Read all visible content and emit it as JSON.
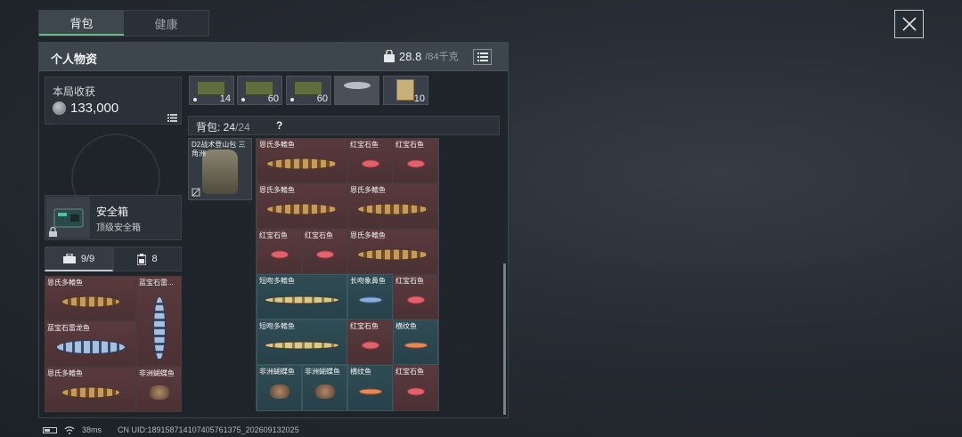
{
  "tabs": [
    {
      "label": "背包",
      "active": true
    },
    {
      "label": "健康",
      "active": false
    }
  ],
  "panel": {
    "title": "个人物资",
    "weight_current": "28.8",
    "weight_max": "/84千克"
  },
  "stats": {
    "label": "本局收获",
    "value": "133,000"
  },
  "safe_box": {
    "name": "安全箱",
    "subtitle": "顶级安全箱"
  },
  "inventory_tabs": [
    {
      "label": "9/9",
      "icon": "briefcase-icon",
      "active": true
    },
    {
      "label": "8",
      "icon": "clipboard-icon",
      "active": false
    }
  ],
  "top_items": [
    {
      "count": "14",
      "icon": "ammo-box-icon"
    },
    {
      "count": "60",
      "icon": "ammo-box-icon"
    },
    {
      "count": "60",
      "icon": "ammo-box-icon"
    },
    {
      "count": "",
      "icon": "fish-icon"
    },
    {
      "count": "10",
      "icon": "medicine-pack-icon"
    }
  ],
  "backpack_bar": {
    "label": "背包: ",
    "count": "24",
    "capacity": "/24",
    "help": "?"
  },
  "equipped_backpack": {
    "name": "D2战术登山包 三角洲"
  },
  "safe_items": [
    {
      "name": "恩氏多鳍鱼",
      "kind": "long"
    },
    {
      "name": "蓝宝石雷...",
      "kind": "tall"
    },
    {
      "name": "蓝宝石雷龙鱼",
      "kind": "long-blue"
    },
    {
      "name": "恩氏多鳍鱼",
      "kind": "long"
    },
    {
      "name": "非洲蝴蝶鱼",
      "kind": "moth"
    }
  ],
  "grid_items": [
    {
      "name": "恩氏多鳍鱼"
    },
    {
      "name": "红宝石鱼"
    },
    {
      "name": "红宝石鱼"
    },
    {
      "name": "恩氏多鳍鱼"
    },
    {
      "name": "恩氏多鳍鱼"
    },
    {
      "name": "红宝石鱼"
    },
    {
      "name": "红宝石鱼"
    },
    {
      "name": "恩氏多鳍鱼"
    },
    {
      "name": "短吻多鳍鱼"
    },
    {
      "name": "长吻象鼻鱼"
    },
    {
      "name": "红宝石鱼"
    },
    {
      "name": "短吻多鳍鱼"
    },
    {
      "name": "红宝石鱼"
    },
    {
      "name": "横纹鱼"
    },
    {
      "name": "非洲蝴蝶鱼"
    },
    {
      "name": "非洲蝴蝶鱼"
    },
    {
      "name": "横纹鱼"
    },
    {
      "name": "红宝石鱼"
    }
  ],
  "footer": {
    "ping": "38ms",
    "uid": "CN UID:1891587141074057613​75_202609132025"
  }
}
